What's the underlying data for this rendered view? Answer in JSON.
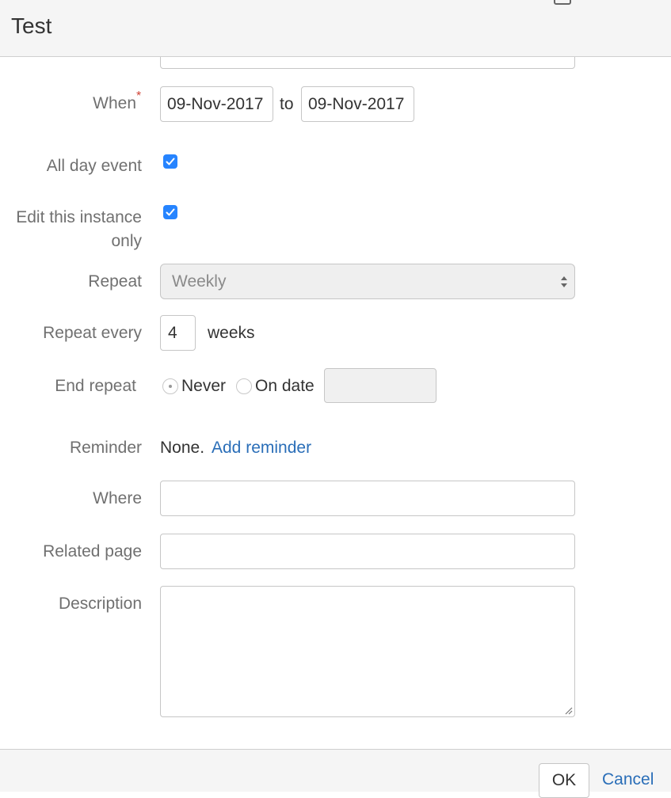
{
  "dialog": {
    "title": "Test"
  },
  "form": {
    "when": {
      "label": "When",
      "start": "09-Nov-2017",
      "separator": "to",
      "end": "09-Nov-2017"
    },
    "all_day": {
      "label": "All day event"
    },
    "edit_instance": {
      "label_line1": "Edit this instance",
      "label_line2": "only"
    },
    "repeat": {
      "label": "Repeat",
      "value": "Weekly"
    },
    "repeat_every": {
      "label": "Repeat every",
      "value": "4",
      "unit": "weeks"
    },
    "end_repeat": {
      "label": "End repeat",
      "option_never": "Never",
      "option_on_date": "On date"
    },
    "reminder": {
      "label": "Reminder",
      "value": "None.",
      "link": "Add reminder"
    },
    "where": {
      "label": "Where"
    },
    "related_page": {
      "label": "Related page"
    },
    "description": {
      "label": "Description"
    }
  },
  "footer": {
    "ok_label": "OK",
    "cancel_label": "Cancel"
  },
  "colors": {
    "link": "#2a6eb8",
    "checkbox": "#2684ff",
    "required": "#d04437",
    "header_bg": "#f5f5f5"
  }
}
